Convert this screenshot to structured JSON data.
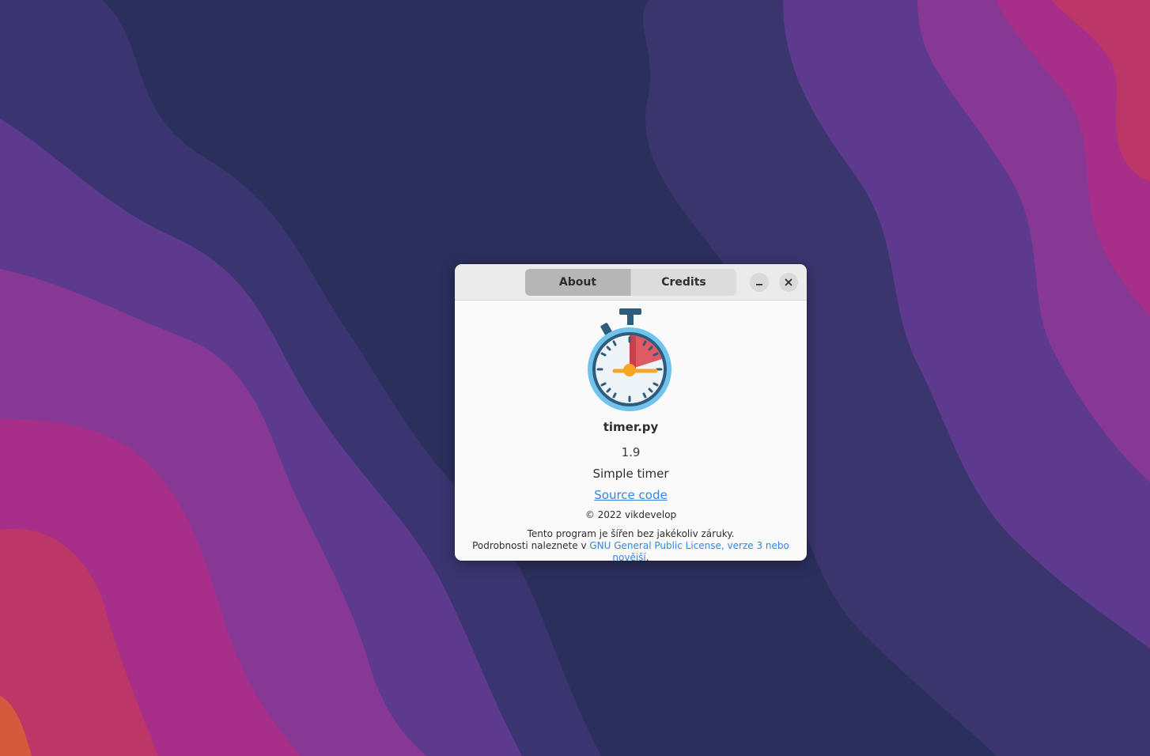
{
  "dialog": {
    "tabs": [
      {
        "label": "About",
        "active": true
      },
      {
        "label": "Credits",
        "active": false
      }
    ],
    "minimize_icon": "minimize-icon",
    "close_icon": "close-icon"
  },
  "about": {
    "icon": "stopwatch-icon",
    "app_name": "timer.py",
    "version": "1.9",
    "comment": "Simple timer",
    "website_label": "Source code",
    "copyright": "© 2022 vikdevelop",
    "license_line1": "Tento program je šířen bez jakékoliv záruky.",
    "license_line2_prefix": "Podrobnosti naleznete v ",
    "license_link": "GNU General Public License, verze 3 nebo novější",
    "license_line2_suffix": "."
  },
  "colors": {
    "accent": "#3584e4",
    "dialog_bg": "#fafafa",
    "header_bg": "#ebebeb"
  }
}
